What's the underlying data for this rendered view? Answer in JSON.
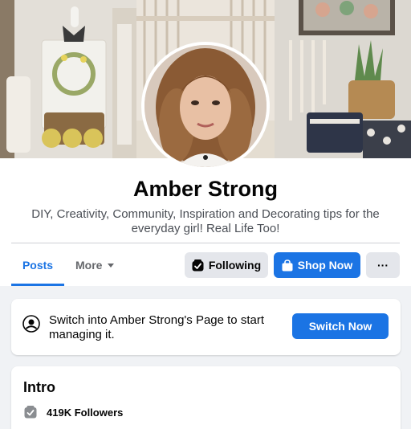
{
  "profile": {
    "name": "Amber Strong",
    "bio": "DIY, Creativity, Community, Inspiration and Decorating tips for the everyday girl! Real Life Too!"
  },
  "tabs": [
    {
      "label": "Posts",
      "active": true
    },
    {
      "label": "More",
      "active": false
    }
  ],
  "actions": {
    "following_label": "Following",
    "shop_label": "Shop Now",
    "more_label": "···"
  },
  "switch_prompt": {
    "text": "Switch into Amber Strong's Page to start managing it.",
    "button_label": "Switch Now"
  },
  "intro": {
    "title": "Intro",
    "followers": "419K Followers"
  },
  "icons": {
    "following": "following-check-icon",
    "shop": "shopping-bag-icon",
    "switch": "profile-switch-icon",
    "followers": "followers-check-icon",
    "more_caret": "caret-down-icon"
  },
  "colors": {
    "accent": "#1b74e4",
    "page_background": "#f0f2f5",
    "button_secondary": "#e4e6eb",
    "text_primary": "#050505",
    "text_secondary": "#65676b"
  }
}
